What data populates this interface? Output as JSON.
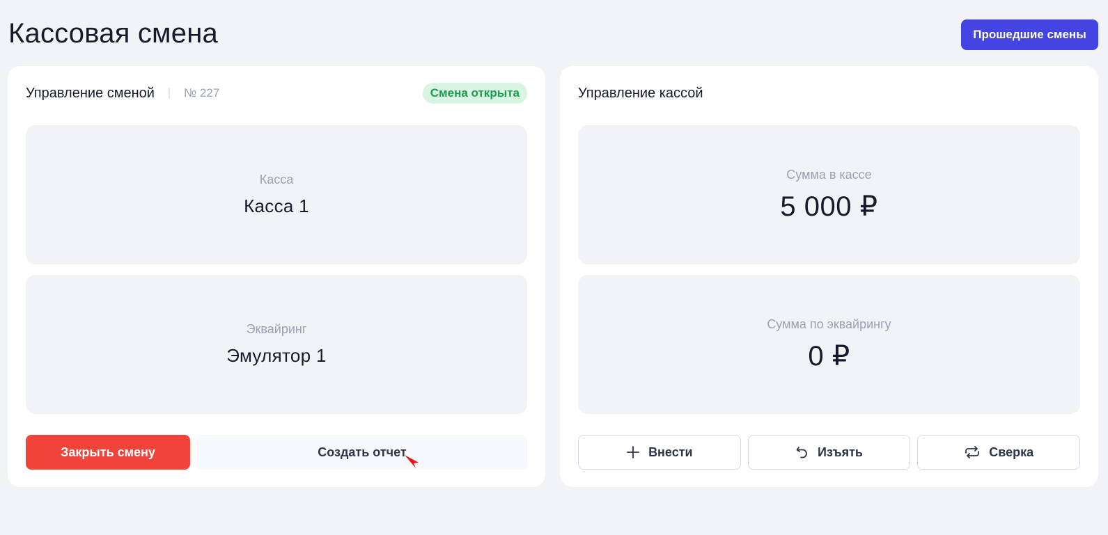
{
  "header": {
    "title": "Кассовая смена",
    "history_button": "Прошедшие смены"
  },
  "shift": {
    "title": "Управление сменой",
    "number": "№ 227",
    "status": "Смена открыта",
    "register_label": "Касса",
    "register_value": "Касса 1",
    "acquiring_label": "Эквайринг",
    "acquiring_value": "Эмулятор 1",
    "close_button": "Закрыть смену",
    "report_button": "Создать отчет"
  },
  "cash": {
    "title": "Управление кассой",
    "cash_label": "Сумма в кассе",
    "cash_value": "5 000 ₽",
    "acquiring_label": "Сумма по эквайрингу",
    "acquiring_value": "0 ₽",
    "deposit_button": "Внести",
    "withdraw_button": "Изъять",
    "reconcile_button": "Сверка"
  },
  "colors": {
    "primary": "#4444e3",
    "danger": "#f0443a",
    "success_text": "#1d9a4f",
    "success_bg": "#d8f5e3",
    "background": "#f2f3f7"
  },
  "icons": {
    "deposit": "plus-icon",
    "withdraw": "undo-icon",
    "reconcile": "refresh-icon"
  }
}
